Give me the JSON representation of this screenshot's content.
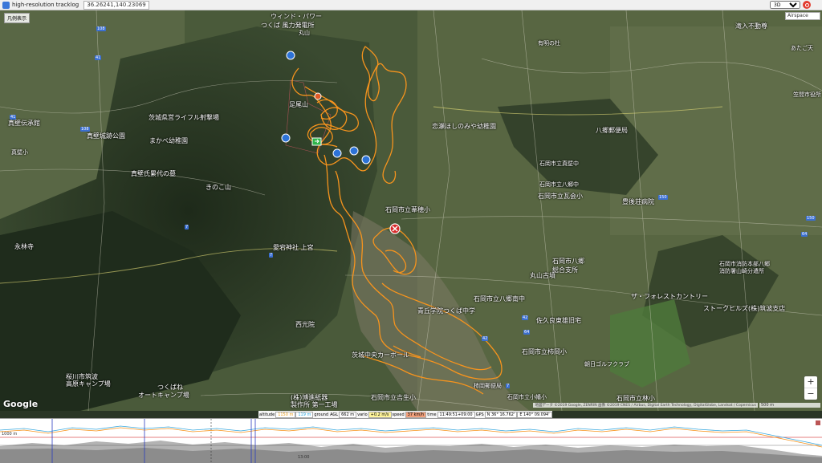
{
  "topbar": {
    "title": "high-resolution tracklog",
    "coordinates": "36.26241,140.23069",
    "view_mode": "3D"
  },
  "map": {
    "legend_button": "凡例表示",
    "airspace_label": "Airspace",
    "zoom_in": "+",
    "zoom_out": "−",
    "brand": "Google",
    "attribution": "地図データ ©2019 Google, ZENRIN 画像 ©2019 CNES / Airbus, Digital Earth Technology, DigitalGlobe, Landsat / Copernicus",
    "scale": "500 m",
    "track_color": "#f7941d",
    "labels": [
      {
        "text": "ウィンド・パワー",
        "cls": ""
      },
      {
        "text": "つくば 風力発電所",
        "cls": ""
      },
      {
        "text": "丸山",
        "cls": "sm"
      },
      {
        "text": "有明の杜",
        "cls": "sm"
      },
      {
        "text": "滝入不動尊",
        "cls": ""
      },
      {
        "text": "あたご天",
        "cls": "sm"
      },
      {
        "text": "足尾山",
        "cls": ""
      },
      {
        "text": "笠間市役所",
        "cls": "sm"
      },
      {
        "text": "茨城県営ライフル射撃場",
        "cls": ""
      },
      {
        "text": "恋瀬ほしのみや幼稚園",
        "cls": ""
      },
      {
        "text": "八郷郵便局",
        "cls": ""
      },
      {
        "text": "真壁伝承館",
        "cls": ""
      },
      {
        "text": "真壁城跡公園",
        "cls": ""
      },
      {
        "text": "まかべ幼稚園",
        "cls": ""
      },
      {
        "text": "真壁小",
        "cls": "sm"
      },
      {
        "text": "石岡市立真壁中",
        "cls": "sm"
      },
      {
        "text": "真壁氏累代の墓",
        "cls": ""
      },
      {
        "text": "きのこ山",
        "cls": ""
      },
      {
        "text": "石岡市立八郷中",
        "cls": "sm"
      },
      {
        "text": "石岡市立瓦会小",
        "cls": ""
      },
      {
        "text": "石岡市立葦穂小",
        "cls": ""
      },
      {
        "text": "豊後荘病院",
        "cls": ""
      },
      {
        "text": "永林寺",
        "cls": ""
      },
      {
        "text": "愛宕神社 上宮",
        "cls": ""
      },
      {
        "text": "石岡市八郷",
        "cls": ""
      },
      {
        "text": "総合支所",
        "cls": ""
      },
      {
        "text": "石岡市消防本部八郷",
        "cls": "sm"
      },
      {
        "text": "消防署山崎分遣所",
        "cls": "sm"
      },
      {
        "text": "丸山古墳",
        "cls": ""
      },
      {
        "text": "石岡市立八郷南中",
        "cls": ""
      },
      {
        "text": "ザ・フォレストカントリー",
        "cls": ""
      },
      {
        "text": "ストークヒルズ(株)筑波支店",
        "cls": ""
      },
      {
        "text": "青丘学院つくば中学",
        "cls": ""
      },
      {
        "text": "佐久良東雄旧宅",
        "cls": ""
      },
      {
        "text": "西光院",
        "cls": ""
      },
      {
        "text": "茨城中央カーボール",
        "cls": ""
      },
      {
        "text": "石岡市立柿岡小",
        "cls": ""
      },
      {
        "text": "朝日ゴルフクラブ",
        "cls": "sm"
      },
      {
        "text": "桜川市筑波",
        "cls": ""
      },
      {
        "text": "高原キャンプ場",
        "cls": ""
      },
      {
        "text": "つくばね",
        "cls": ""
      },
      {
        "text": "オートキャンプ場",
        "cls": ""
      },
      {
        "text": "(株)博進紙器",
        "cls": ""
      },
      {
        "text": "製作所 第一工場",
        "cls": ""
      },
      {
        "text": "石岡市立吉生小",
        "cls": ""
      },
      {
        "text": "柿岡郵便局",
        "cls": "sm"
      },
      {
        "text": "石岡市立林小",
        "cls": ""
      },
      {
        "text": "石岡市立小幡小",
        "cls": "sm"
      }
    ],
    "route_numbers": [
      "108",
      "41",
      "41",
      "108",
      "7",
      "7",
      "7",
      "42",
      "42",
      "150",
      "64",
      "64",
      "150"
    ]
  },
  "statusbar": {
    "altitude_label": "altitude",
    "altitude_value": "1150 m",
    "ground_value": "119 m",
    "ground_label": "ground",
    "agl_label": "AGL",
    "agl_value": "662 m",
    "vario_label": "vario",
    "vario_value": "+0.2 m/s",
    "speed_label": "speed",
    "speed_value": "37 km/h",
    "time_label": "time",
    "time_value": "11:49:51+09:00",
    "gps_label": "GPS",
    "lat_value": "N 36° 16.762'",
    "lon_value": "E 140° 09.094'"
  },
  "profile": {
    "y_label": "1000 m",
    "x_label": "13:00",
    "altitude_color": "#f7941d",
    "ground_color": "#39a9e0"
  }
}
